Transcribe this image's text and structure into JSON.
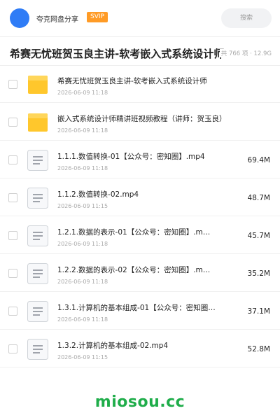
{
  "header": {
    "brand": "夸克网盘分享",
    "badge": "SVIP",
    "search_label": "搜索"
  },
  "share": {
    "title": "希赛无忧班贺玉良主讲-软考嵌入式系统设计师",
    "count_size": "共 766 项 · 12.9G"
  },
  "files": [
    {
      "type": "folder",
      "name": "希赛无忧班贺玉良主讲-软考嵌入式系统设计师",
      "date": "2026-06-09 11:18",
      "size": ""
    },
    {
      "type": "folder",
      "name": "嵌入式系统设计师精讲班视频教程（讲师：贺玉良）",
      "date": "2026-06-09 11:18",
      "size": ""
    },
    {
      "type": "file",
      "name": "1.1.1.数值转换-01【公众号：密知圈】.mp4",
      "date": "2026-06-09 11:18",
      "size": "69.4M"
    },
    {
      "type": "file",
      "name": "1.1.2.数值转换-02.mp4",
      "date": "2026-06-09 11:15",
      "size": "48.7M"
    },
    {
      "type": "file",
      "name": "1.2.1.数据的表示-01【公众号：密知圈】.m…",
      "date": "2026-06-09 11:18",
      "size": "45.7M"
    },
    {
      "type": "file",
      "name": "1.2.2.数据的表示-02【公众号：密知圈】.m…",
      "date": "2026-06-09 11:18",
      "size": "35.2M"
    },
    {
      "type": "file",
      "name": "1.3.1.计算机的基本组成-01【公众号：密知圈…",
      "date": "2026-06-09 11:18",
      "size": "37.1M"
    },
    {
      "type": "file",
      "name": "1.3.2.计算机的基本组成-02.mp4",
      "date": "2026-06-09 11:15",
      "size": "52.8M"
    }
  ],
  "watermark": "miosou.cc",
  "colors": {
    "accent_blue": "#2f7cf6",
    "svip_orange": "#ff9b26",
    "folder_yellow": "#ffc72c",
    "watermark_green": "#1fad4a"
  }
}
